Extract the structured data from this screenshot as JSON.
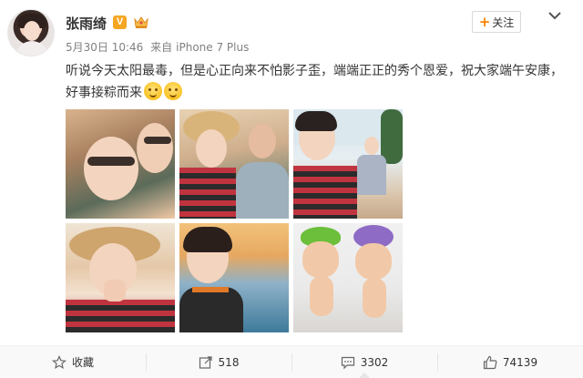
{
  "user": {
    "name": "张雨绮",
    "verified_badge": "V",
    "crown_icon": "crown-icon"
  },
  "meta": {
    "date": "5月30日 10:46",
    "source_prefix": "来自",
    "source": "iPhone 7 Plus"
  },
  "follow_button": {
    "label": "关注",
    "icon": "+"
  },
  "menu_icon": "chevron-down-icon",
  "post": {
    "text": "听说今天太阳最毒，但是心正向来不怕影子歪，端端正正的秀个恩爱，祝大家端午安康，好事接粽而来",
    "emoji_count": 2,
    "photo_count": 6
  },
  "actions": {
    "favorite_label": "收藏",
    "repost_count": "518",
    "comment_count": "3302",
    "like_count": "74139"
  },
  "colors": {
    "accent": "#ff8200",
    "badge": "#f5a623",
    "text": "#333333",
    "muted": "#808080",
    "action_bar": "#f9f9f9"
  }
}
